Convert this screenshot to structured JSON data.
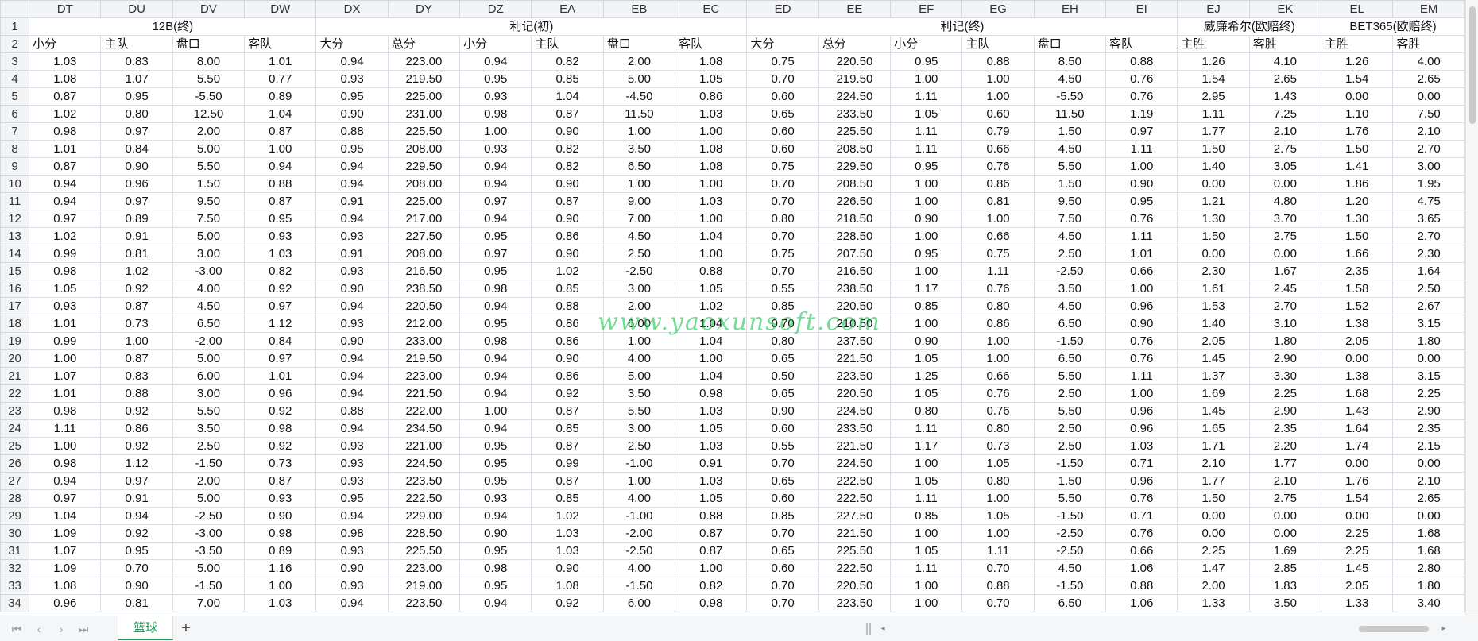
{
  "columns": [
    "DT",
    "DU",
    "DV",
    "DW",
    "DX",
    "DY",
    "DZ",
    "EA",
    "EB",
    "EC",
    "ED",
    "EE",
    "EF",
    "EG",
    "EH",
    "EI",
    "EJ",
    "EK",
    "EL",
    "EM"
  ],
  "group_headers": [
    {
      "label": "12B(终)",
      "span": 4
    },
    {
      "label": "利记(初)",
      "span": 6
    },
    {
      "label": "利记(终)",
      "span": 6
    },
    {
      "label": "威廉希尔(欧赔终)",
      "span": 2
    },
    {
      "label": "BET365(欧赔终)",
      "span": 2
    }
  ],
  "sub_headers": [
    "小分",
    "主队",
    "盘口",
    "客队",
    "大分",
    "总分",
    "小分",
    "主队",
    "盘口",
    "客队",
    "大分",
    "总分",
    "小分",
    "主队",
    "盘口",
    "客队",
    "主胜",
    "客胜",
    "主胜",
    "客胜"
  ],
  "header_row_numbers": [
    "1",
    "2"
  ],
  "rows": [
    {
      "n": "3",
      "v": [
        "1.03",
        "0.83",
        "8.00",
        "1.01",
        "0.94",
        "223.00",
        "0.94",
        "0.82",
        "2.00",
        "1.08",
        "0.75",
        "220.50",
        "0.95",
        "0.88",
        "8.50",
        "0.88",
        "1.26",
        "4.10",
        "1.26",
        "4.00"
      ]
    },
    {
      "n": "4",
      "v": [
        "1.08",
        "1.07",
        "5.50",
        "0.77",
        "0.93",
        "219.50",
        "0.95",
        "0.85",
        "5.00",
        "1.05",
        "0.70",
        "219.50",
        "1.00",
        "1.00",
        "4.50",
        "0.76",
        "1.54",
        "2.65",
        "1.54",
        "2.65"
      ]
    },
    {
      "n": "5",
      "v": [
        "0.87",
        "0.95",
        "-5.50",
        "0.89",
        "0.95",
        "225.00",
        "0.93",
        "1.04",
        "-4.50",
        "0.86",
        "0.60",
        "224.50",
        "1.11",
        "1.00",
        "-5.50",
        "0.76",
        "2.95",
        "1.43",
        "0.00",
        "0.00"
      ]
    },
    {
      "n": "6",
      "v": [
        "1.02",
        "0.80",
        "12.50",
        "1.04",
        "0.90",
        "231.00",
        "0.98",
        "0.87",
        "11.50",
        "1.03",
        "0.65",
        "233.50",
        "1.05",
        "0.60",
        "11.50",
        "1.19",
        "1.11",
        "7.25",
        "1.10",
        "7.50"
      ]
    },
    {
      "n": "7",
      "v": [
        "0.98",
        "0.97",
        "2.00",
        "0.87",
        "0.88",
        "225.50",
        "1.00",
        "0.90",
        "1.00",
        "1.00",
        "0.60",
        "225.50",
        "1.11",
        "0.79",
        "1.50",
        "0.97",
        "1.77",
        "2.10",
        "1.76",
        "2.10"
      ]
    },
    {
      "n": "8",
      "v": [
        "1.01",
        "0.84",
        "5.00",
        "1.00",
        "0.95",
        "208.00",
        "0.93",
        "0.82",
        "3.50",
        "1.08",
        "0.60",
        "208.50",
        "1.11",
        "0.66",
        "4.50",
        "1.11",
        "1.50",
        "2.75",
        "1.50",
        "2.70"
      ]
    },
    {
      "n": "9",
      "v": [
        "0.87",
        "0.90",
        "5.50",
        "0.94",
        "0.94",
        "229.50",
        "0.94",
        "0.82",
        "6.50",
        "1.08",
        "0.75",
        "229.50",
        "0.95",
        "0.76",
        "5.50",
        "1.00",
        "1.40",
        "3.05",
        "1.41",
        "3.00"
      ]
    },
    {
      "n": "10",
      "v": [
        "0.94",
        "0.96",
        "1.50",
        "0.88",
        "0.94",
        "208.00",
        "0.94",
        "0.90",
        "1.00",
        "1.00",
        "0.70",
        "208.50",
        "1.00",
        "0.86",
        "1.50",
        "0.90",
        "0.00",
        "0.00",
        "1.86",
        "1.95"
      ]
    },
    {
      "n": "11",
      "v": [
        "0.94",
        "0.97",
        "9.50",
        "0.87",
        "0.91",
        "225.00",
        "0.97",
        "0.87",
        "9.00",
        "1.03",
        "0.70",
        "226.50",
        "1.00",
        "0.81",
        "9.50",
        "0.95",
        "1.21",
        "4.80",
        "1.20",
        "4.75"
      ]
    },
    {
      "n": "12",
      "v": [
        "0.97",
        "0.89",
        "7.50",
        "0.95",
        "0.94",
        "217.00",
        "0.94",
        "0.90",
        "7.00",
        "1.00",
        "0.80",
        "218.50",
        "0.90",
        "1.00",
        "7.50",
        "0.76",
        "1.30",
        "3.70",
        "1.30",
        "3.65"
      ]
    },
    {
      "n": "13",
      "v": [
        "1.02",
        "0.91",
        "5.00",
        "0.93",
        "0.93",
        "227.50",
        "0.95",
        "0.86",
        "4.50",
        "1.04",
        "0.70",
        "228.50",
        "1.00",
        "0.66",
        "4.50",
        "1.11",
        "1.50",
        "2.75",
        "1.50",
        "2.70"
      ]
    },
    {
      "n": "14",
      "v": [
        "0.99",
        "0.81",
        "3.00",
        "1.03",
        "0.91",
        "208.00",
        "0.97",
        "0.90",
        "2.50",
        "1.00",
        "0.75",
        "207.50",
        "0.95",
        "0.75",
        "2.50",
        "1.01",
        "0.00",
        "0.00",
        "1.66",
        "2.30"
      ]
    },
    {
      "n": "15",
      "v": [
        "0.98",
        "1.02",
        "-3.00",
        "0.82",
        "0.93",
        "216.50",
        "0.95",
        "1.02",
        "-2.50",
        "0.88",
        "0.70",
        "216.50",
        "1.00",
        "1.11",
        "-2.50",
        "0.66",
        "2.30",
        "1.67",
        "2.35",
        "1.64"
      ]
    },
    {
      "n": "16",
      "v": [
        "1.05",
        "0.92",
        "4.00",
        "0.92",
        "0.90",
        "238.50",
        "0.98",
        "0.85",
        "3.00",
        "1.05",
        "0.55",
        "238.50",
        "1.17",
        "0.76",
        "3.50",
        "1.00",
        "1.61",
        "2.45",
        "1.58",
        "2.50"
      ]
    },
    {
      "n": "17",
      "v": [
        "0.93",
        "0.87",
        "4.50",
        "0.97",
        "0.94",
        "220.50",
        "0.94",
        "0.88",
        "2.00",
        "1.02",
        "0.85",
        "220.50",
        "0.85",
        "0.80",
        "4.50",
        "0.96",
        "1.53",
        "2.70",
        "1.52",
        "2.67"
      ]
    },
    {
      "n": "18",
      "v": [
        "1.01",
        "0.73",
        "6.50",
        "1.12",
        "0.93",
        "212.00",
        "0.95",
        "0.86",
        "6.00",
        "1.04",
        "0.70",
        "210.50",
        "1.00",
        "0.86",
        "6.50",
        "0.90",
        "1.40",
        "3.10",
        "1.38",
        "3.15"
      ]
    },
    {
      "n": "19",
      "v": [
        "0.99",
        "1.00",
        "-2.00",
        "0.84",
        "0.90",
        "233.00",
        "0.98",
        "0.86",
        "1.00",
        "1.04",
        "0.80",
        "237.50",
        "0.90",
        "1.00",
        "-1.50",
        "0.76",
        "2.05",
        "1.80",
        "2.05",
        "1.80"
      ]
    },
    {
      "n": "20",
      "v": [
        "1.00",
        "0.87",
        "5.00",
        "0.97",
        "0.94",
        "219.50",
        "0.94",
        "0.90",
        "4.00",
        "1.00",
        "0.65",
        "221.50",
        "1.05",
        "1.00",
        "6.50",
        "0.76",
        "1.45",
        "2.90",
        "0.00",
        "0.00"
      ]
    },
    {
      "n": "21",
      "v": [
        "1.07",
        "0.83",
        "6.00",
        "1.01",
        "0.94",
        "223.00",
        "0.94",
        "0.86",
        "5.00",
        "1.04",
        "0.50",
        "223.50",
        "1.25",
        "0.66",
        "5.50",
        "1.11",
        "1.37",
        "3.30",
        "1.38",
        "3.15"
      ]
    },
    {
      "n": "22",
      "v": [
        "1.01",
        "0.88",
        "3.00",
        "0.96",
        "0.94",
        "221.50",
        "0.94",
        "0.92",
        "3.50",
        "0.98",
        "0.65",
        "220.50",
        "1.05",
        "0.76",
        "2.50",
        "1.00",
        "1.69",
        "2.25",
        "1.68",
        "2.25"
      ]
    },
    {
      "n": "23",
      "v": [
        "0.98",
        "0.92",
        "5.50",
        "0.92",
        "0.88",
        "222.00",
        "1.00",
        "0.87",
        "5.50",
        "1.03",
        "0.90",
        "224.50",
        "0.80",
        "0.76",
        "5.50",
        "0.96",
        "1.45",
        "2.90",
        "1.43",
        "2.90"
      ]
    },
    {
      "n": "24",
      "v": [
        "1.11",
        "0.86",
        "3.50",
        "0.98",
        "0.94",
        "234.50",
        "0.94",
        "0.85",
        "3.00",
        "1.05",
        "0.60",
        "233.50",
        "1.11",
        "0.80",
        "2.50",
        "0.96",
        "1.65",
        "2.35",
        "1.64",
        "2.35"
      ]
    },
    {
      "n": "25",
      "v": [
        "1.00",
        "0.92",
        "2.50",
        "0.92",
        "0.93",
        "221.00",
        "0.95",
        "0.87",
        "2.50",
        "1.03",
        "0.55",
        "221.50",
        "1.17",
        "0.73",
        "2.50",
        "1.03",
        "1.71",
        "2.20",
        "1.74",
        "2.15"
      ]
    },
    {
      "n": "26",
      "v": [
        "0.98",
        "1.12",
        "-1.50",
        "0.73",
        "0.93",
        "224.50",
        "0.95",
        "0.99",
        "-1.00",
        "0.91",
        "0.70",
        "224.50",
        "1.00",
        "1.05",
        "-1.50",
        "0.71",
        "2.10",
        "1.77",
        "0.00",
        "0.00"
      ]
    },
    {
      "n": "27",
      "v": [
        "0.94",
        "0.97",
        "2.00",
        "0.87",
        "0.93",
        "223.50",
        "0.95",
        "0.87",
        "1.00",
        "1.03",
        "0.65",
        "222.50",
        "1.05",
        "0.80",
        "1.50",
        "0.96",
        "1.77",
        "2.10",
        "1.76",
        "2.10"
      ]
    },
    {
      "n": "28",
      "v": [
        "0.97",
        "0.91",
        "5.00",
        "0.93",
        "0.95",
        "222.50",
        "0.93",
        "0.85",
        "4.00",
        "1.05",
        "0.60",
        "222.50",
        "1.11",
        "1.00",
        "5.50",
        "0.76",
        "1.50",
        "2.75",
        "1.54",
        "2.65"
      ]
    },
    {
      "n": "29",
      "v": [
        "1.04",
        "0.94",
        "-2.50",
        "0.90",
        "0.94",
        "229.00",
        "0.94",
        "1.02",
        "-1.00",
        "0.88",
        "0.85",
        "227.50",
        "0.85",
        "1.05",
        "-1.50",
        "0.71",
        "0.00",
        "0.00",
        "0.00",
        "0.00"
      ]
    },
    {
      "n": "30",
      "v": [
        "1.09",
        "0.92",
        "-3.00",
        "0.98",
        "0.98",
        "228.50",
        "0.90",
        "1.03",
        "-2.00",
        "0.87",
        "0.70",
        "221.50",
        "1.00",
        "1.00",
        "-2.50",
        "0.76",
        "0.00",
        "0.00",
        "2.25",
        "1.68"
      ]
    },
    {
      "n": "31",
      "v": [
        "1.07",
        "0.95",
        "-3.50",
        "0.89",
        "0.93",
        "225.50",
        "0.95",
        "1.03",
        "-2.50",
        "0.87",
        "0.65",
        "225.50",
        "1.05",
        "1.11",
        "-2.50",
        "0.66",
        "2.25",
        "1.69",
        "2.25",
        "1.68"
      ]
    },
    {
      "n": "32",
      "v": [
        "1.09",
        "0.70",
        "5.00",
        "1.16",
        "0.90",
        "223.00",
        "0.98",
        "0.90",
        "4.00",
        "1.00",
        "0.60",
        "222.50",
        "1.11",
        "0.70",
        "4.50",
        "1.06",
        "1.47",
        "2.85",
        "1.45",
        "2.80"
      ]
    },
    {
      "n": "33",
      "v": [
        "1.08",
        "0.90",
        "-1.50",
        "1.00",
        "0.93",
        "219.00",
        "0.95",
        "1.08",
        "-1.50",
        "0.82",
        "0.70",
        "220.50",
        "1.00",
        "0.88",
        "-1.50",
        "0.88",
        "2.00",
        "1.83",
        "2.05",
        "1.80"
      ]
    },
    {
      "n": "34",
      "v": [
        "0.96",
        "0.81",
        "7.00",
        "1.03",
        "0.94",
        "223.50",
        "0.94",
        "0.92",
        "6.00",
        "0.98",
        "0.70",
        "223.50",
        "1.00",
        "0.70",
        "6.50",
        "1.06",
        "1.33",
        "3.50",
        "1.33",
        "3.40"
      ]
    }
  ],
  "sheet_tab": {
    "label": "篮球"
  },
  "add_sheet_glyph": "+",
  "nav": {
    "first": "⏮",
    "prev": "‹",
    "next": "›",
    "last": "⏭"
  },
  "watermark": "www.yaoxunsoft.com",
  "colors": {
    "tab_active": "#1d9b57",
    "grid_line": "#d9dde6",
    "header_bg": "#f3f4f6"
  }
}
